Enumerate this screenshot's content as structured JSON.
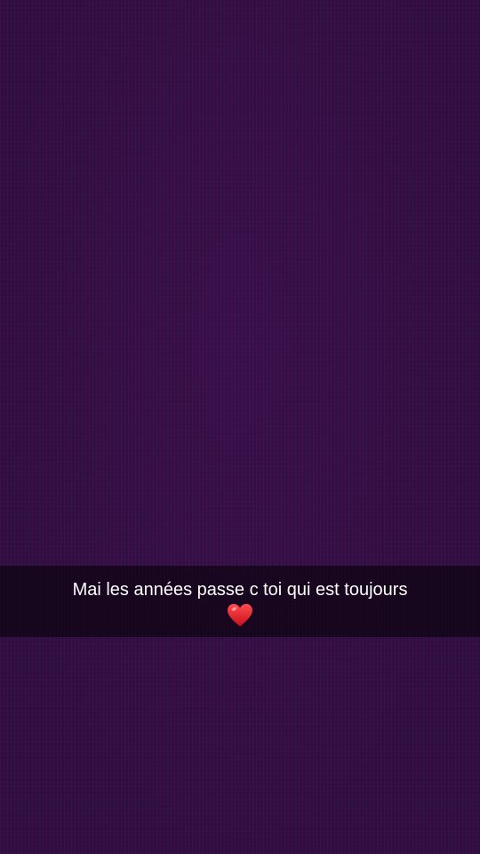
{
  "caption": {
    "text": "Mai les années passe c toi qui est toujours",
    "emoji_icon": "red-heart-icon"
  },
  "colors": {
    "background": "#2a0f3f",
    "caption_bar": "rgba(0,0,0,0.55)",
    "caption_text": "#ffffff",
    "heart": "#e0202e"
  }
}
